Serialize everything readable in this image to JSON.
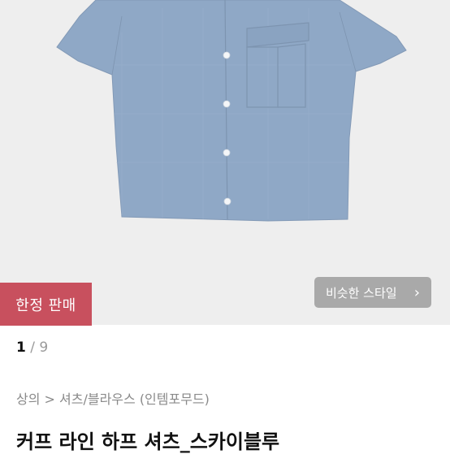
{
  "badge": {
    "label": "한정 판매"
  },
  "similar_style": {
    "label": "비슷한 스타일",
    "chevron": "›"
  },
  "counter": {
    "current": "1",
    "separator": " / ",
    "total": "9"
  },
  "breadcrumb": {
    "text": "상의 > 셔츠/블라우스 (인템포무드)"
  },
  "product": {
    "title": "커프 라인 하프 셔츠_스카이블루"
  },
  "colors": {
    "shirt": "#8fa8c6",
    "badge": "#c8505e",
    "image_bg": "#eeeeee"
  }
}
